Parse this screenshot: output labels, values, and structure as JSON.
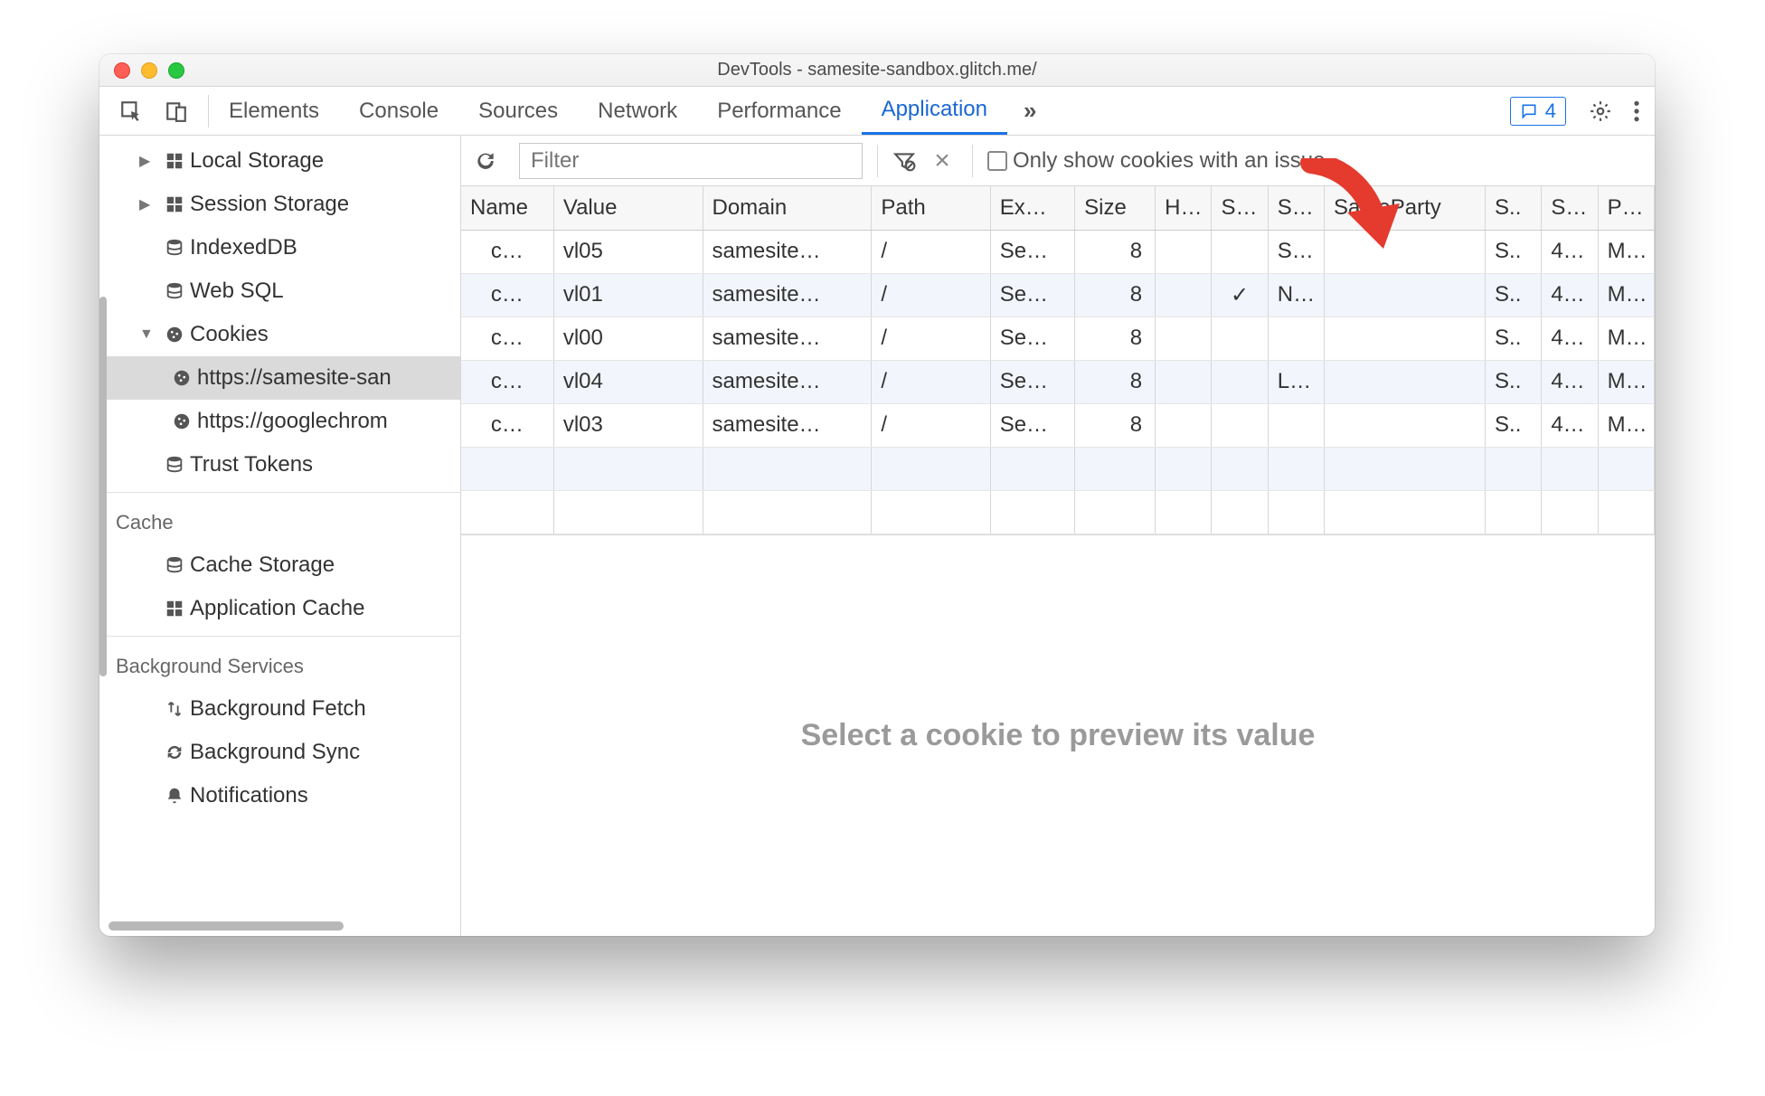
{
  "window": {
    "title": "DevTools - samesite-sandbox.glitch.me/"
  },
  "tabs": {
    "items": [
      "Elements",
      "Console",
      "Sources",
      "Network",
      "Performance",
      "Application"
    ],
    "active": "Application",
    "more_glyph": "»"
  },
  "issues": {
    "count": "4"
  },
  "sidebar": {
    "storage": [
      {
        "label": "Local Storage",
        "arrow": "▶",
        "icon": "grid"
      },
      {
        "label": "Session Storage",
        "arrow": "▶",
        "icon": "grid"
      },
      {
        "label": "IndexedDB",
        "arrow": "",
        "icon": "db"
      },
      {
        "label": "Web SQL",
        "arrow": "",
        "icon": "db"
      },
      {
        "label": "Cookies",
        "arrow": "▼",
        "icon": "cookie"
      }
    ],
    "cookie_origins": [
      {
        "label": "https://samesite-san",
        "selected": true
      },
      {
        "label": "https://googlechrom",
        "selected": false
      }
    ],
    "trust_tokens": {
      "label": "Trust Tokens",
      "icon": "db"
    },
    "cache_heading": "Cache",
    "cache": [
      {
        "label": "Cache Storage",
        "icon": "db"
      },
      {
        "label": "Application Cache",
        "icon": "grid"
      }
    ],
    "bg_heading": "Background Services",
    "bg": [
      {
        "label": "Background Fetch",
        "icon": "updown"
      },
      {
        "label": "Background Sync",
        "icon": "sync"
      },
      {
        "label": "Notifications",
        "icon": "bell"
      }
    ]
  },
  "toolbar": {
    "filter_placeholder": "Filter",
    "only_issues_label": "Only show cookies with an issue"
  },
  "cookies": {
    "columns": [
      "Name",
      "Value",
      "Domain",
      "Path",
      "Ex…",
      "Size",
      "H…",
      "S…",
      "S…",
      "SameParty",
      "S..",
      "S…",
      "P…"
    ],
    "rows": [
      {
        "name": "c…",
        "value": "vl05",
        "domain": "samesite…",
        "path": "/",
        "exp": "Se…",
        "size": "8",
        "http": "",
        "secure": "",
        "samesite": "S…",
        "sameparty": "",
        "s2": "S..",
        "s3": "4…",
        "p": "M…"
      },
      {
        "name": "c…",
        "value": "vl01",
        "domain": "samesite…",
        "path": "/",
        "exp": "Se…",
        "size": "8",
        "http": "",
        "secure": "✓",
        "samesite": "N…",
        "sameparty": "",
        "s2": "S..",
        "s3": "4…",
        "p": "M…"
      },
      {
        "name": "c…",
        "value": "vl00",
        "domain": "samesite…",
        "path": "/",
        "exp": "Se…",
        "size": "8",
        "http": "",
        "secure": "",
        "samesite": "",
        "sameparty": "",
        "s2": "S..",
        "s3": "4…",
        "p": "M…"
      },
      {
        "name": "c…",
        "value": "vl04",
        "domain": "samesite…",
        "path": "/",
        "exp": "Se…",
        "size": "8",
        "http": "",
        "secure": "",
        "samesite": "L…",
        "sameparty": "",
        "s2": "S..",
        "s3": "4…",
        "p": "M…"
      },
      {
        "name": "c…",
        "value": "vl03",
        "domain": "samesite…",
        "path": "/",
        "exp": "Se…",
        "size": "8",
        "http": "",
        "secure": "",
        "samesite": "",
        "sameparty": "",
        "s2": "S..",
        "s3": "4…",
        "p": "M…"
      }
    ]
  },
  "preview": {
    "message": "Select a cookie to preview its value"
  }
}
